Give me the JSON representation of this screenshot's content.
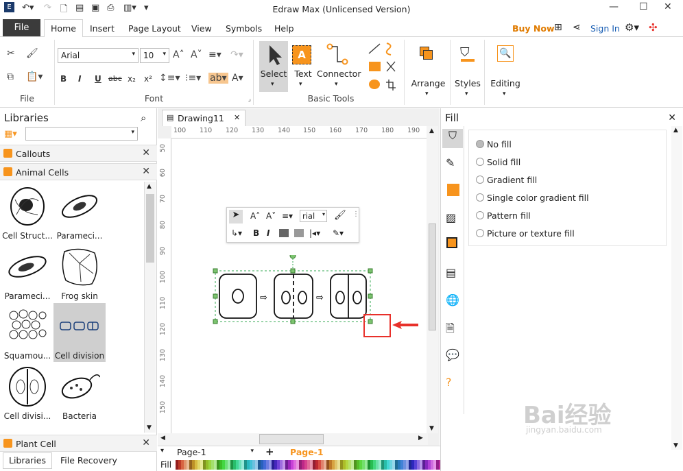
{
  "window": {
    "title": "Edraw Max (Unlicensed Version)",
    "buy_now": "Buy Now",
    "sign_in": "Sign In"
  },
  "menu_tabs": [
    "File",
    "Home",
    "Insert",
    "Page Layout",
    "View",
    "Symbols",
    "Help"
  ],
  "ribbon": {
    "file_group_label": "File",
    "font_group_label": "Font",
    "font_name": "Arial",
    "font_size": "10",
    "basic_tools_label": "Basic Tools",
    "select_label": "Select",
    "text_label": "Text",
    "connector_label": "Connector",
    "arrange_label": "Arrange",
    "styles_label": "Styles",
    "editing_label": "Editing"
  },
  "libraries": {
    "title": "Libraries",
    "sections": [
      "Callouts",
      "Animal Cells",
      "Plant Cell"
    ],
    "shapes": [
      "Cell Struct...",
      "Parameci...",
      "Parameci...",
      "Frog skin",
      "Squamou...",
      "Cell division",
      "Cell divisi...",
      "Bacteria"
    ],
    "bottom_tabs": [
      "Libraries",
      "File Recovery"
    ]
  },
  "document": {
    "tab_name": "Drawing11",
    "h_ruler": [
      "100",
      "110",
      "120",
      "130",
      "140",
      "150",
      "160",
      "170",
      "180",
      "190"
    ],
    "v_ruler": [
      "50",
      "60",
      "70",
      "80",
      "90",
      "100",
      "110",
      "120",
      "130",
      "140",
      "150"
    ],
    "float_font": "rial",
    "page_select": "Page-1",
    "page_tab": "Page-1",
    "status_fill": "Fill"
  },
  "fill_panel": {
    "title": "Fill",
    "options": [
      "No fill",
      "Solid fill",
      "Gradient fill",
      "Single color gradient fill",
      "Pattern fill",
      "Picture or texture fill"
    ],
    "selected": "No fill"
  },
  "colors": {
    "accent_orange": "#f7941d",
    "buy_now": "#e07b00",
    "sign_in": "#1a5fb4",
    "highlight_red": "#e8302a",
    "selection_green": "#34a853"
  },
  "watermark": {
    "text": "Bai经验",
    "url": "jingyan.baidu.com"
  }
}
